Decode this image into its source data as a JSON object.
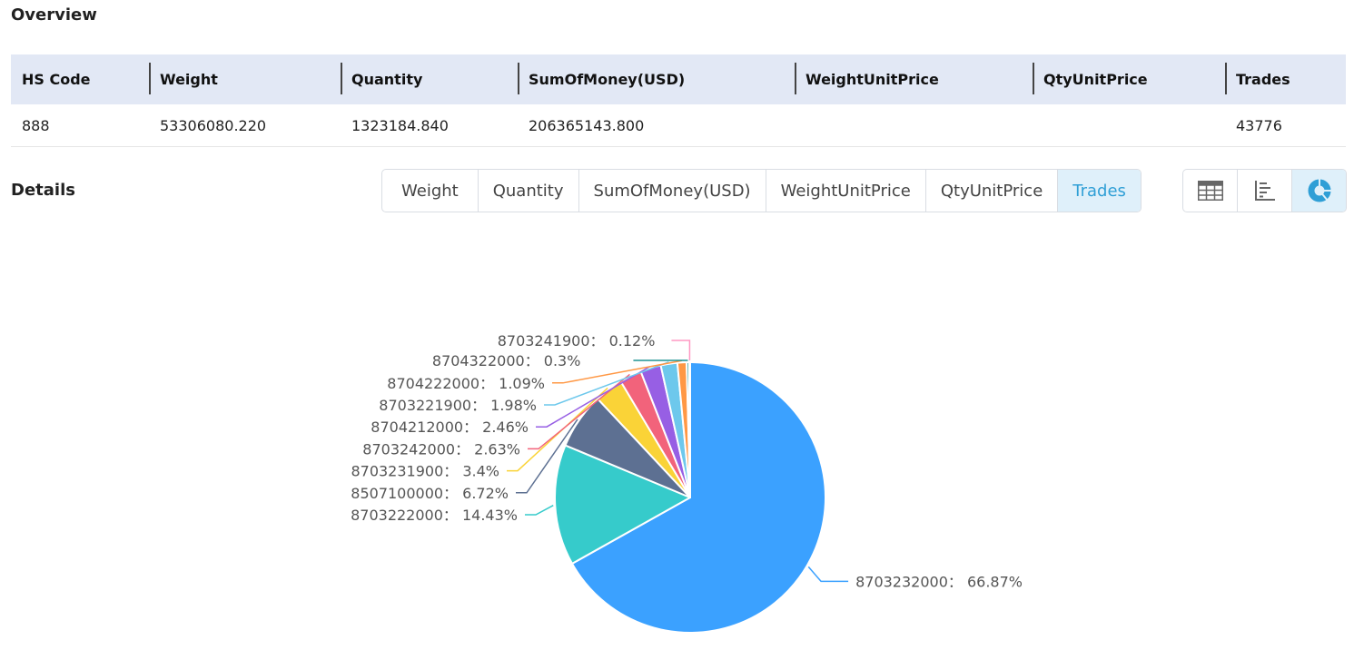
{
  "overview": {
    "title": "Overview",
    "columns": [
      "HS Code",
      "Weight",
      "Quantity",
      "SumOfMoney(USD)",
      "WeightUnitPrice",
      "QtyUnitPrice",
      "Trades"
    ],
    "rows": [
      [
        "888",
        "53306080.220",
        "1323184.840",
        "206365143.800",
        "",
        "",
        "43776"
      ]
    ]
  },
  "details": {
    "title": "Details",
    "tabs": [
      {
        "label": "Weight",
        "active": false
      },
      {
        "label": "Quantity",
        "active": false
      },
      {
        "label": "SumOfMoney(USD)",
        "active": false
      },
      {
        "label": "WeightUnitPrice",
        "active": false
      },
      {
        "label": "QtyUnitPrice",
        "active": false
      },
      {
        "label": "Trades",
        "active": true
      }
    ],
    "view_buttons": [
      {
        "icon": "table-icon",
        "active": false
      },
      {
        "icon": "bar-chart-icon",
        "active": false
      },
      {
        "icon": "pie-chart-icon",
        "active": true
      }
    ],
    "accent_color": "#2f9fd6"
  },
  "chart_data": {
    "type": "pie",
    "title": "",
    "start": "top, clockwise",
    "label_separator": "：",
    "slices": [
      {
        "label": "8703232000",
        "value": 66.87,
        "color": "#3ba1ff"
      },
      {
        "label": "8703222000",
        "value": 14.43,
        "color": "#36cbcb"
      },
      {
        "label": "8507100000",
        "value": 6.72,
        "color": "#5d7092"
      },
      {
        "label": "8703231900",
        "value": 3.4,
        "color": "#fad337"
      },
      {
        "label": "8703242000",
        "value": 2.63,
        "color": "#f2637b"
      },
      {
        "label": "8704212000",
        "value": 2.46,
        "color": "#975fe4"
      },
      {
        "label": "8703221900",
        "value": 1.98,
        "color": "#6dc8ec"
      },
      {
        "label": "8704222000",
        "value": 1.09,
        "color": "#ff9845"
      },
      {
        "label": "8704322000",
        "value": 0.3,
        "color": "#1e9493"
      },
      {
        "label": "8703241900",
        "value": 0.12,
        "color": "#ff99c3"
      }
    ],
    "unit": "%"
  }
}
